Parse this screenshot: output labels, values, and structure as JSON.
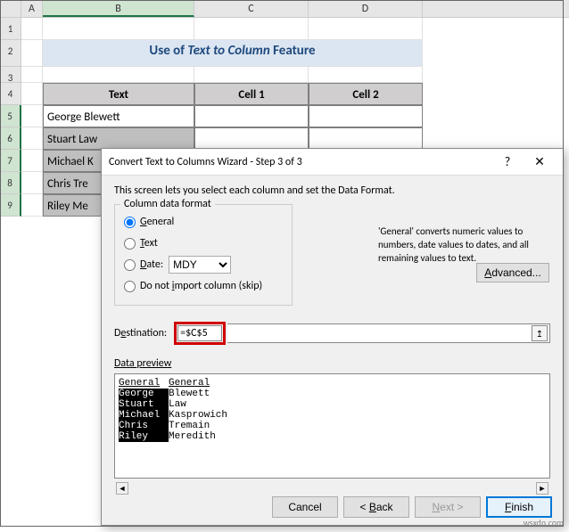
{
  "columns": [
    "A",
    "B",
    "C",
    "D"
  ],
  "rownums": [
    "1",
    "2",
    "3",
    "4",
    "5",
    "6",
    "7",
    "8",
    "9"
  ],
  "title_parts": {
    "prefix": "Use of ",
    "em": "Text to Column",
    "suffix": " Feature"
  },
  "headers": {
    "text": "Text",
    "c1": "Cell 1",
    "c2": "Cell 2"
  },
  "data_rows": [
    {
      "text": "George Blewett"
    },
    {
      "text": "Stuart Law"
    },
    {
      "text": "Michael K"
    },
    {
      "text": "Chris Tre"
    },
    {
      "text": "Riley Me"
    }
  ],
  "dialog": {
    "title": "Convert Text to Columns Wizard - Step 3 of 3",
    "help": "?",
    "close": "✕",
    "desc": "This screen lets you select each column and set the Data Format.",
    "fieldset_legend": "Column data format",
    "radios": {
      "general": "General",
      "text": "Text",
      "date": "Date:",
      "skip": "Do not import column (skip)"
    },
    "date_sel": "MDY",
    "side_text": "'General' converts numeric values to numbers, date values to dates, and all remaining values to text.",
    "advanced": "Advanced...",
    "dest_label": "Destination:",
    "dest_value": "=$C$5",
    "collapse_icon": "↥",
    "preview_label": "Data preview",
    "preview_cols": [
      "General",
      "General"
    ],
    "preview_data": [
      [
        "George",
        "Blewett"
      ],
      [
        "Stuart",
        "Law"
      ],
      [
        "Michael",
        "Kasprowich"
      ],
      [
        "Chris",
        "Tremain"
      ],
      [
        "Riley",
        "Meredith"
      ]
    ],
    "scroll_left": "◄",
    "scroll_right": "►",
    "buttons": {
      "cancel": "Cancel",
      "back": "< Back",
      "next": "Next >",
      "finish": "Finish"
    }
  },
  "watermark": "wsxdn.com"
}
